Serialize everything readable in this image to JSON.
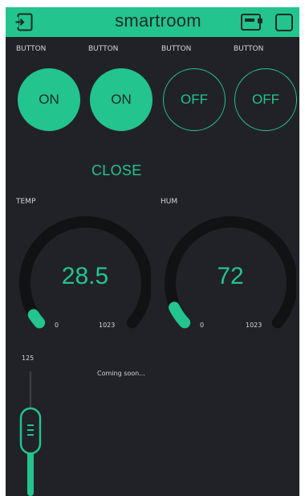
{
  "app": {
    "title": "smartroom"
  },
  "toolbar": {
    "left_icon": "exit-icon",
    "right_icons": [
      "device-icon",
      "square-icon"
    ]
  },
  "buttons": [
    {
      "caption": "BUTTON",
      "label": "ON",
      "state": "on"
    },
    {
      "caption": "BUTTON",
      "label": "ON",
      "state": "on"
    },
    {
      "caption": "BUTTON",
      "label": "OFF",
      "state": "off"
    },
    {
      "caption": "BUTTON",
      "label": "OFF",
      "state": "off"
    }
  ],
  "status": {
    "door_label": "CLOSE"
  },
  "gauges": [
    {
      "caption": "TEMP",
      "value": "28.5",
      "min": "0",
      "max": "1023"
    },
    {
      "caption": "HUM",
      "value": "72",
      "min": "0",
      "max": "1023"
    }
  ],
  "slider": {
    "max_label": "125",
    "level_fraction": 0.15
  },
  "placeholder": {
    "text": "Coming soon..."
  },
  "colors": {
    "accent": "#23c48e",
    "background": "#212227",
    "track": "#111214",
    "text_light": "#d4d6d9",
    "text_dark": "#1e2a28"
  }
}
